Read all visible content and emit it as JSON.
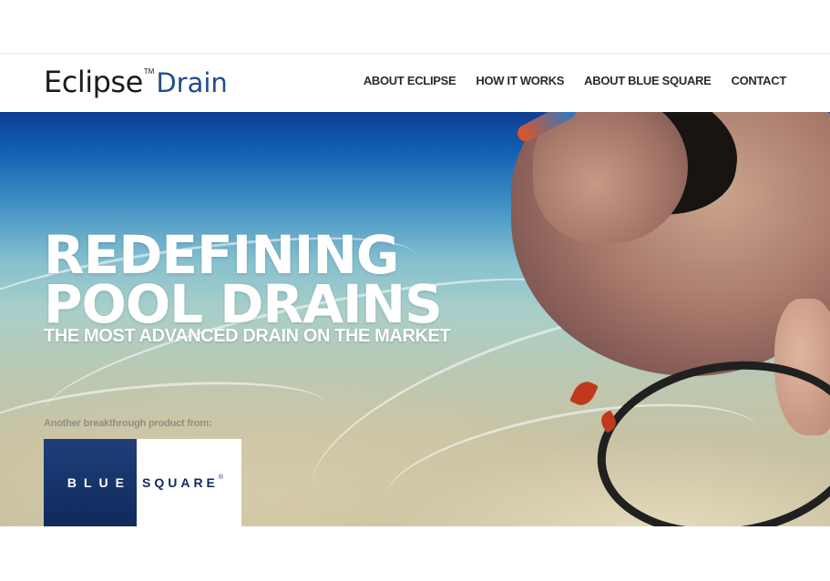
{
  "logo": {
    "primary": "Eclipse",
    "tm": "TM",
    "secondary": "Drain",
    "primary_color": "#1b1b1b",
    "secondary_color": "#1f4e8c"
  },
  "nav": {
    "items": [
      {
        "label": "ABOUT ECLIPSE"
      },
      {
        "label": "HOW IT WORKS"
      },
      {
        "label": "ABOUT BLUE SQUARE"
      },
      {
        "label": "CONTACT"
      }
    ]
  },
  "hero": {
    "headline_line1": "REDEFINING",
    "headline_line2": "POOL DRAINS",
    "subheadline": "THE MOST ADVANCED DRAIN ON THE MARKET",
    "product_from": "Another breakthrough product from:",
    "partner_logo": {
      "part1": "BLUE",
      "part2": "SQUARE",
      "mark": "®",
      "color": "#0f2a5c"
    }
  }
}
